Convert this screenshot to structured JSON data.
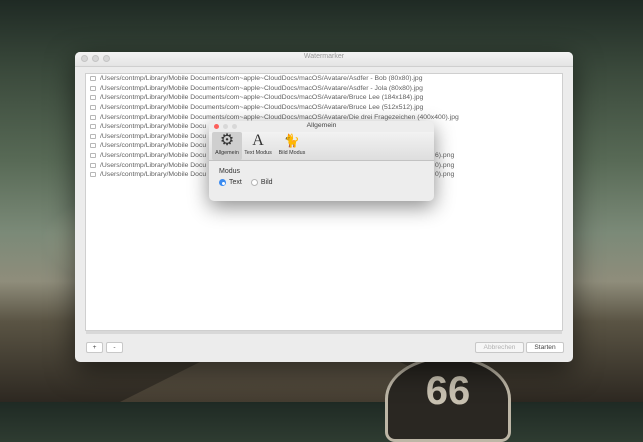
{
  "main_window": {
    "title": "Watermarker",
    "files": [
      "/Users/contmp/Library/Mobile Documents/com~apple~CloudDocs/macOS/Avatare/Asdfer - Bob (80x80).jpg",
      "/Users/contmp/Library/Mobile Documents/com~apple~CloudDocs/macOS/Avatare/Asdfer - Jola (80x80).jpg",
      "/Users/contmp/Library/Mobile Documents/com~apple~CloudDocs/macOS/Avatare/Bruce Lee (184x184).jpg",
      "/Users/contmp/Library/Mobile Documents/com~apple~CloudDocs/macOS/Avatare/Bruce Lee (512x512).jpg",
      "/Users/contmp/Library/Mobile Documents/com~apple~CloudDocs/macOS/Avatare/Die drei Fragezeichen (400x400).jpg",
      "/Users/contmp/Library/Mobile Docu",
      "/Users/contmp/Library/Mobile Docu",
      "/Users/contmp/Library/Mobile Docu",
      "/Users/contmp/Library/Mobile Docu",
      "/Users/contmp/Library/Mobile Docu",
      "/Users/contmp/Library/Mobile Docu"
    ],
    "file_suffixes": [
      "",
      "",
      "",
      "",
      "",
      "",
      "",
      "",
      "6).png",
      "0).png",
      "0).png"
    ],
    "add_label": "+",
    "remove_label": "-",
    "cancel_label": "Abbrechen",
    "start_label": "Starten"
  },
  "dialog": {
    "title": "Allgemein",
    "tabs": [
      {
        "label": "Allgemein",
        "icon": "gear-icon",
        "glyph": "⚙"
      },
      {
        "label": "Text Modus",
        "icon": "font-icon",
        "glyph": "A"
      },
      {
        "label": "Bild Modus",
        "icon": "cat-icon",
        "glyph": "🐈"
      }
    ],
    "mode_label": "Modus",
    "option_text": "Text",
    "option_image": "Bild",
    "selected": "Text"
  },
  "colors": {
    "accent": "#3b8bf0",
    "close": "#fc605c"
  }
}
